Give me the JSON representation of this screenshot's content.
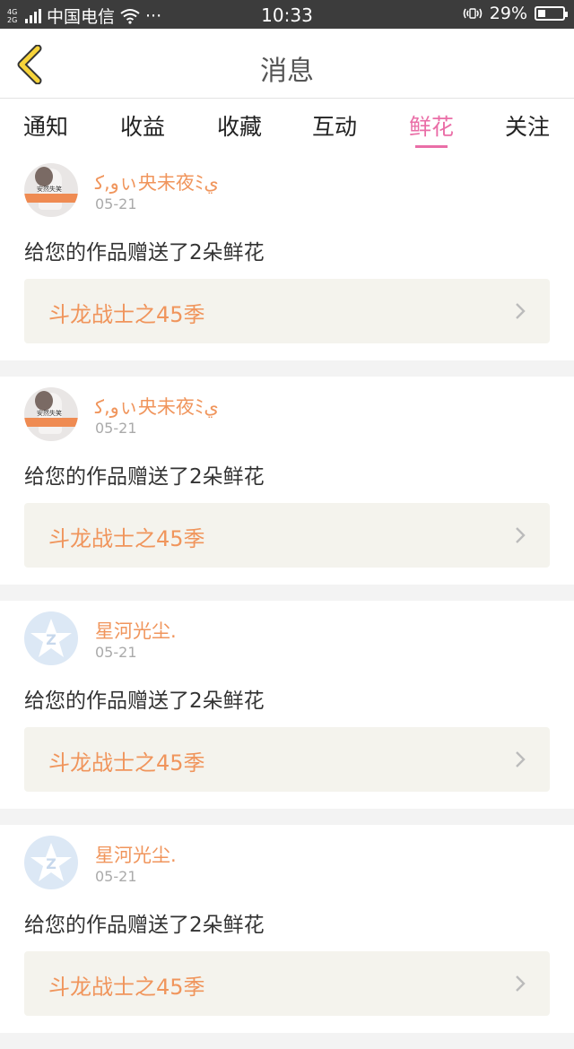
{
  "status_bar": {
    "network": "4G 2G",
    "carrier": "中国电信",
    "more": "···",
    "time": "10:33",
    "battery": "29%",
    "battery_level": 0.29
  },
  "header": {
    "title": "消息"
  },
  "tabs": [
    {
      "label": "通知",
      "active": false
    },
    {
      "label": "收益",
      "active": false
    },
    {
      "label": "收藏",
      "active": false
    },
    {
      "label": "互动",
      "active": false
    },
    {
      "label": "鲜花",
      "active": true
    },
    {
      "label": "关注",
      "active": false
    }
  ],
  "colors": {
    "accent": "#ea6ea7",
    "name": "#f0955c",
    "card_bg": "#f4f3ed"
  },
  "messages": [
    {
      "user": "ﻭ,ﮐぃ央未夜ﾐﻱ",
      "date": "05-21",
      "avatar": "photo-avatar",
      "avatar_caption": "安然失笑",
      "text": "给您的作品赠送了2朵鲜花",
      "work": "斗龙战士之45季"
    },
    {
      "user": "ﻭ,ﮐぃ央未夜ﾐﻱ",
      "date": "05-21",
      "avatar": "photo-avatar",
      "avatar_caption": "安然失笑",
      "text": "给您的作品赠送了2朵鲜花",
      "work": "斗龙战士之45季"
    },
    {
      "user": "星河光尘.",
      "date": "05-21",
      "avatar": "qq-default-avatar",
      "text": "给您的作品赠送了2朵鲜花",
      "work": "斗龙战士之45季"
    },
    {
      "user": "星河光尘.",
      "date": "05-21",
      "avatar": "qq-default-avatar",
      "text": "给您的作品赠送了2朵鲜花",
      "work": "斗龙战士之45季"
    }
  ]
}
